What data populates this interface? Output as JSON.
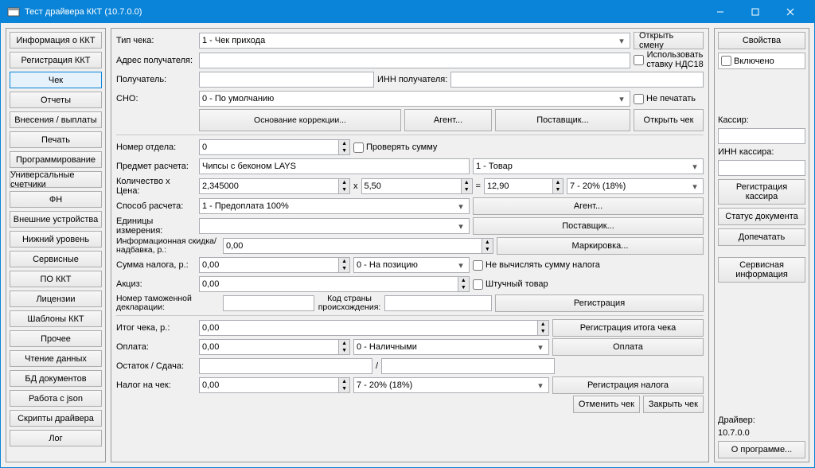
{
  "window": {
    "title": "Тест драйвера ККТ (10.7.0.0)"
  },
  "sidebar": {
    "items": [
      "Информация о ККТ",
      "Регистрация ККТ",
      "Чек",
      "Отчеты",
      "Внесения / выплаты",
      "Печать",
      "Программирование",
      "Универсальные счетчики",
      "ФН",
      "Внешние устройства",
      "Нижний уровень",
      "Сервисные",
      "ПО ККТ",
      "Лицензии",
      "Шаблоны ККТ",
      "Прочее",
      "Чтение данных",
      "БД документов",
      "Работа с json",
      "Скрипты драйвера",
      "Лог"
    ],
    "active_index": 2
  },
  "main": {
    "receipt_type_label": "Тип чека:",
    "receipt_type_value": "1 - Чек прихода",
    "open_shift": "Открыть смену",
    "recipient_addr_label": "Адрес получателя:",
    "recipient_label": "Получатель:",
    "inn_recipient_label": "ИНН получателя:",
    "use_vat18": "Использовать ставку НДС18",
    "sno_label": "СНО:",
    "sno_value": "0 - По умолчанию",
    "no_print": "Не печатать",
    "correction_basis": "Основание коррекции...",
    "agent_btn": "Агент...",
    "supplier_btn": "Поставщик...",
    "open_receipt": "Открыть чек",
    "dept_label": "Номер отдела:",
    "dept_value": "0",
    "verify_sum": "Проверять сумму",
    "subject_label": "Предмет расчета:",
    "subject_value": "Чипсы с беконом LAYS",
    "subject_type": "1 - Товар",
    "qty_price_label": "Количество x Цена:",
    "qty": "2,345000",
    "times": "x",
    "price": "5,50",
    "equals": "=",
    "total": "12,90",
    "tax_rate": "7 - 20% (18%)",
    "method_label": "Способ расчета:",
    "method_value": "1 - Предоплата 100%",
    "agent2": "Агент...",
    "units_label": "Единицы измерения:",
    "supplier2": "Поставщик...",
    "discount_label": "Информационная скидка/надбавка, р.:",
    "discount_value": "0,00",
    "marking": "Маркировка...",
    "tax_amount_label": "Сумма налога, р.:",
    "tax_amount_value": "0,00",
    "tax_position": "0 - На позицию",
    "no_calc_tax": "Не вычислять сумму налога",
    "excise_label": "Акциз:",
    "excise_value": "0,00",
    "piece_goods": "Штучный товар",
    "customs_label": "Номер таможенной декларации:",
    "country_label": "Код страны происхождения:",
    "register": "Регистрация",
    "receipt_total_label": "Итог чека, р.:",
    "receipt_total_value": "0,00",
    "register_total": "Регистрация итога чека",
    "payment_label": "Оплата:",
    "payment_value": "0,00",
    "payment_type": "0 - Наличными",
    "payment_btn": "Оплата",
    "change_label": "Остаток / Сдача:",
    "slash": "/",
    "tax_on_receipt_label": "Налог на чек:",
    "tax_on_receipt_value": "0,00",
    "tax_on_receipt_rate": "7 - 20% (18%)",
    "register_tax": "Регистрация налога",
    "cancel_receipt": "Отменить чек",
    "close_receipt": "Закрыть чек"
  },
  "right": {
    "properties": "Свойства",
    "enabled": "Включено",
    "cashier_label": "Кассир:",
    "cashier_inn_label": "ИНН кассира:",
    "cashier_reg": "Регистрация кассира",
    "doc_status": "Статус документа",
    "print_more": "Допечатать",
    "service_info": "Сервисная информация",
    "driver_label": "Драйвер:",
    "driver_ver": "10.7.0.0",
    "about": "О программе..."
  }
}
